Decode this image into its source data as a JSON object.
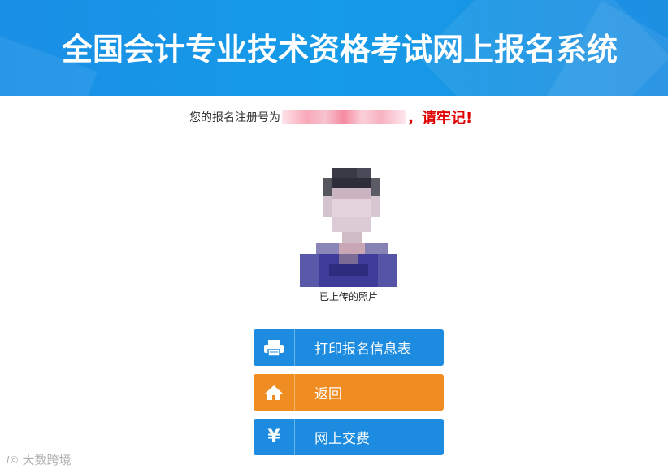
{
  "header": {
    "title": "全国会计专业技术资格考试网上报名系统"
  },
  "registration": {
    "prefix": "您的报名注册号为",
    "warning": "，请牢记!"
  },
  "photo": {
    "caption": "已上传的照片"
  },
  "buttons": [
    {
      "label": "打印报名信息表",
      "icon": "printer-icon",
      "color": "#1d8ce0"
    },
    {
      "label": "返回",
      "icon": "home-icon",
      "color": "#ef8d22"
    },
    {
      "label": "网上交费",
      "icon": "yen-icon",
      "icon_text": "¥",
      "color": "#1d8ce0"
    }
  ],
  "watermark": {
    "logo": "I©",
    "text": "大数跨境"
  }
}
